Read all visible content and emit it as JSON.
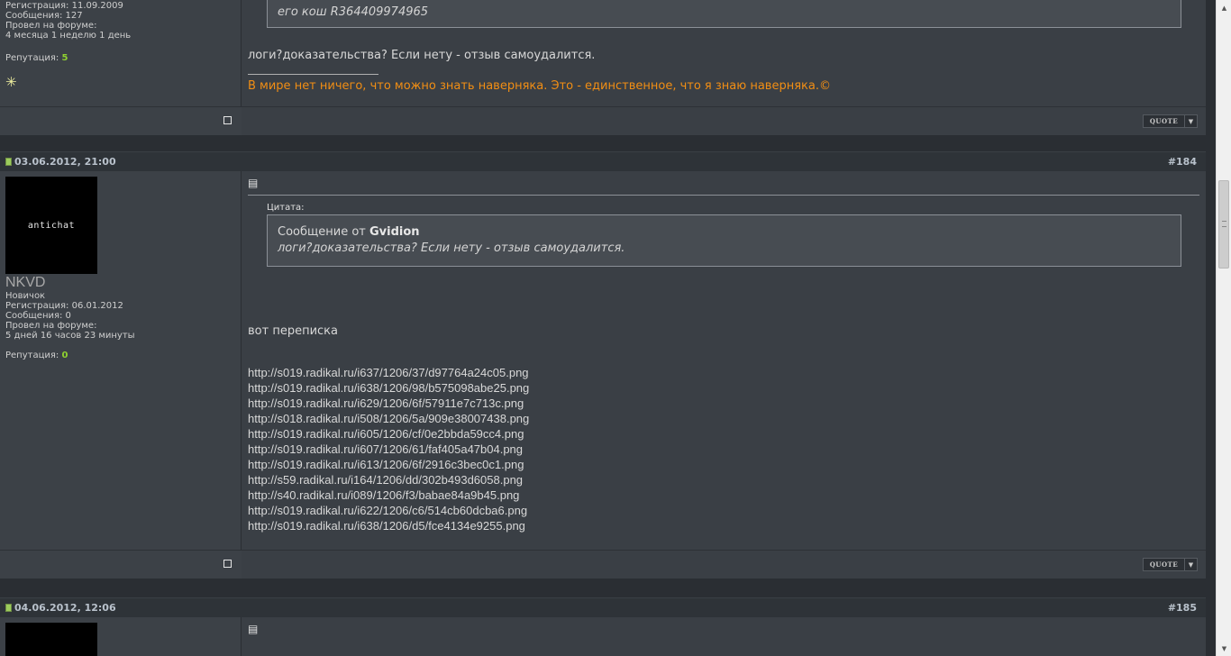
{
  "post1": {
    "user": {
      "registration": "Регистрация: 11.09.2009",
      "messages": "Сообщения: 127",
      "spent_label": "Провел на форуме:",
      "spent_value": "4 месяца 1 неделю 1 день",
      "rep_label": "Репутация: ",
      "rep_value": "5",
      "award_icon": "sparkle-icon"
    },
    "quote_tail": "его кош R364409974965",
    "text": "логи?доказательства? Если нету - отзыв самоудалится.",
    "signature": "В мире нет ничего, что можно знать наверняка. Это - единственное, что я знаю наверняка.©",
    "quote_button": "QUOTE",
    "quote_arrow": "▼"
  },
  "post2": {
    "date": "03.06.2012, 21:00",
    "number": "#184",
    "user": {
      "avatar_text": "antichat",
      "name": "NKVD",
      "rank": "Новичок",
      "registration": "Регистрация: 06.01.2012",
      "messages": "Сообщения: 0",
      "spent_label": "Провел на форуме:",
      "spent_value": "5 дней 16 часов 23 минуты",
      "rep_label": "Репутация: ",
      "rep_value": "0"
    },
    "quote_label": "Цитата:",
    "quote_from_prefix": "Сообщение от ",
    "quote_from_user": "Gvidion",
    "quote_text": "логи?доказательства? Если нету - отзыв самоудалится.",
    "text": "вот переписка",
    "links": [
      "http://s019.radikal.ru/i637/1206/37/d97764a24c05.png",
      "http://s019.radikal.ru/i638/1206/98/b575098abe25.png",
      "http://s019.radikal.ru/i629/1206/6f/57911e7c713c.png",
      "http://s018.radikal.ru/i508/1206/5a/909e38007438.png",
      "http://s019.radikal.ru/i605/1206/cf/0e2bbda59cc4.png",
      "http://s019.radikal.ru/i607/1206/61/faf405a47b04.png",
      "http://s019.radikal.ru/i613/1206/6f/2916c3bec0c1.png",
      "http://s59.radikal.ru/i164/1206/dd/302b493d6058.png",
      "http://s40.radikal.ru/i089/1206/f3/babae84a9b45.png",
      "http://s019.radikal.ru/i622/1206/c6/514cb60dcba6.png",
      "http://s019.radikal.ru/i638/1206/d5/fce4134e9255.png"
    ],
    "quote_button": "QUOTE",
    "quote_arrow": "▼"
  },
  "post3": {
    "date": "04.06.2012, 12:06",
    "number": "#185"
  },
  "colors": {
    "background": "#2a2e33",
    "reputation": "#8fd130",
    "signature": "#f18e14"
  }
}
